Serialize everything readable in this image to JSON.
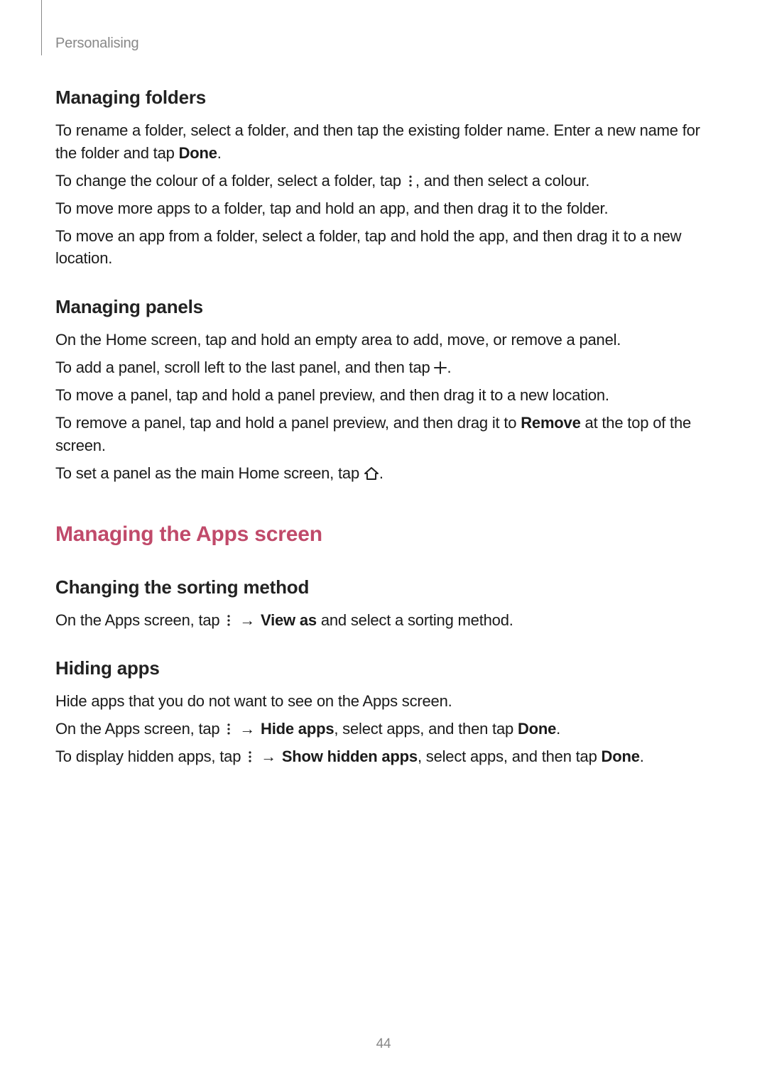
{
  "header": {
    "breadcrumb": "Personalising"
  },
  "page_number": "44",
  "arrow": "→",
  "sections": {
    "mf": {
      "title": "Managing folders",
      "p1_a": "To rename a folder, select a folder, and then tap the existing folder name. Enter a new name for the folder and tap ",
      "p1_b": "Done",
      "p1_c": ".",
      "p2_a": "To change the colour of a folder, select a folder, tap ",
      "p2_b": ", and then select a colour.",
      "p3": "To move more apps to a folder, tap and hold an app, and then drag it to the folder.",
      "p4": "To move an app from a folder, select a folder, tap and hold the app, and then drag it to a new location."
    },
    "mp": {
      "title": "Managing panels",
      "p1": "On the Home screen, tap and hold an empty area to add, move, or remove a panel.",
      "p2_a": "To add a panel, scroll left to the last panel, and then tap ",
      "p2_b": ".",
      "p3": "To move a panel, tap and hold a panel preview, and then drag it to a new location.",
      "p4_a": "To remove a panel, tap and hold a panel preview, and then drag it to ",
      "p4_b": "Remove",
      "p4_c": " at the top of the screen.",
      "p5_a": "To set a panel as the main Home screen, tap ",
      "p5_b": "."
    },
    "mas": {
      "title": "Managing the Apps screen",
      "csm": {
        "title": "Changing the sorting method",
        "p1_a": "On the Apps screen, tap ",
        "p1_b": "View as",
        "p1_c": " and select a sorting method."
      },
      "ha": {
        "title": "Hiding apps",
        "p1": "Hide apps that you do not want to see on the Apps screen.",
        "p2_a": "On the Apps screen, tap ",
        "p2_b": "Hide apps",
        "p2_c": ", select apps, and then tap ",
        "p2_d": "Done",
        "p2_e": ".",
        "p3_a": "To display hidden apps, tap ",
        "p3_b": "Show hidden apps",
        "p3_c": ", select apps, and then tap ",
        "p3_d": "Done",
        "p3_e": "."
      }
    }
  }
}
